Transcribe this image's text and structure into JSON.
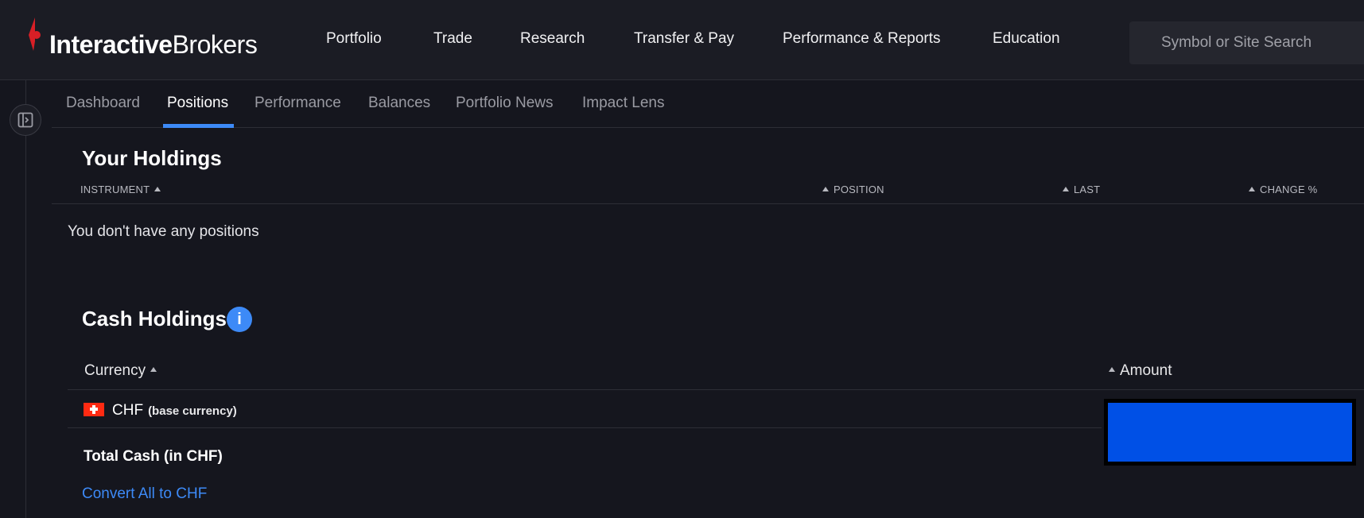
{
  "brand": {
    "bold": "Interactive",
    "light": "Brokers",
    "accent_color": "#d81f26"
  },
  "nav": [
    {
      "label": "Portfolio"
    },
    {
      "label": "Trade"
    },
    {
      "label": "Research"
    },
    {
      "label": "Transfer & Pay"
    },
    {
      "label": "Performance & Reports"
    },
    {
      "label": "Education"
    }
  ],
  "search": {
    "placeholder": "Symbol or Site Search"
  },
  "tabs": [
    {
      "label": "Dashboard"
    },
    {
      "label": "Positions",
      "active": true
    },
    {
      "label": "Performance"
    },
    {
      "label": "Balances"
    },
    {
      "label": "Portfolio News"
    },
    {
      "label": "Impact Lens"
    }
  ],
  "holdings": {
    "title": "Your Holdings",
    "columns": [
      "INSTRUMENT",
      "POSITION",
      "LAST",
      "CHANGE %"
    ],
    "empty_message": "You don't have any positions"
  },
  "cash": {
    "title": "Cash Holdings",
    "info_icon": "i",
    "columns": [
      "Currency",
      "Amount"
    ],
    "rows": [
      {
        "currency": "CHF",
        "note": "(base currency)",
        "flag": "swiss-flag"
      }
    ],
    "total_label": "Total Cash (in CHF)",
    "convert_link": "Convert All to CHF"
  },
  "colors": {
    "accent": "#3d8af7",
    "background": "#15161e",
    "header": "#1b1c24",
    "redaction": "#0050e6"
  }
}
